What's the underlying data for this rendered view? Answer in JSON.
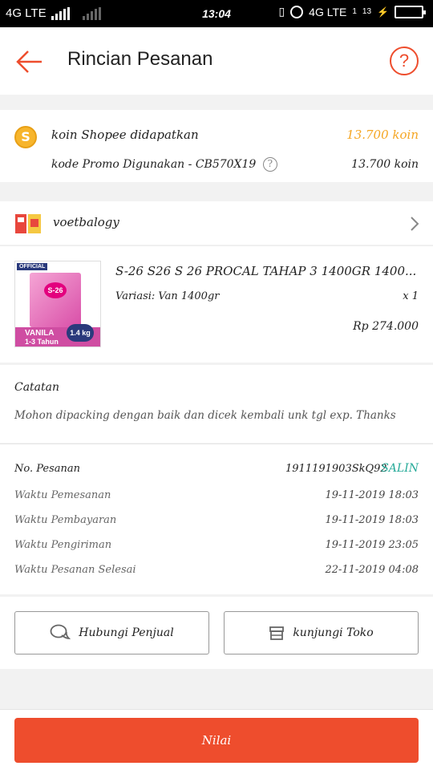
{
  "statusbar": {
    "network_left": "4G LTE",
    "time": "13:04",
    "network_right": "4G LTE",
    "sim_small": "1",
    "sim_small2": "13"
  },
  "appbar": {
    "title": "Rincian Pesanan",
    "help_glyph": "?"
  },
  "coins": {
    "coin_glyph": "S",
    "label": "koin Shopee didapatkan",
    "value": "13.700 koin",
    "promo_label": "kode Promo Digunakan - CB570X19",
    "promo_value": "13.700 koin"
  },
  "shop": {
    "name": "voetbalogy"
  },
  "product": {
    "image_badge": "OFFICIAL",
    "image_brand": "S-26",
    "image_flavor": "VANILA",
    "image_age": "1-3 Tahun",
    "image_size": "1.4 kg",
    "name": "S-26 S26 S 26 PROCAL TAHAP 3 1400GR 1400...",
    "variation": "Variasi: Van 1400gr",
    "qty": "x 1",
    "price": "Rp 274.000"
  },
  "note": {
    "title": "Catatan",
    "text": "Mohon dipacking dengan baik dan dicek kembali unk tgl exp. Thanks"
  },
  "order": {
    "no_label": "No. Pesanan",
    "no_value": "1911191903SkQ92",
    "copy_label": "SALIN",
    "times": [
      {
        "label": "Waktu Pemesanan",
        "value": "19-11-2019 18:03"
      },
      {
        "label": "Waktu Pembayaran",
        "value": "19-11-2019 18:03"
      },
      {
        "label": "Waktu Pengiriman",
        "value": "19-11-2019 23:05"
      },
      {
        "label": "Waktu Pesanan Selesai",
        "value": "22-11-2019 04:08"
      }
    ]
  },
  "actions": {
    "chat_label": "Hubungi Penjual",
    "visit_label": "kunjungi Toko",
    "rate_label": "Nilai"
  },
  "colors": {
    "accent": "#ee4d2d",
    "coin_text": "#f5a623",
    "copy": "#26aa99"
  }
}
